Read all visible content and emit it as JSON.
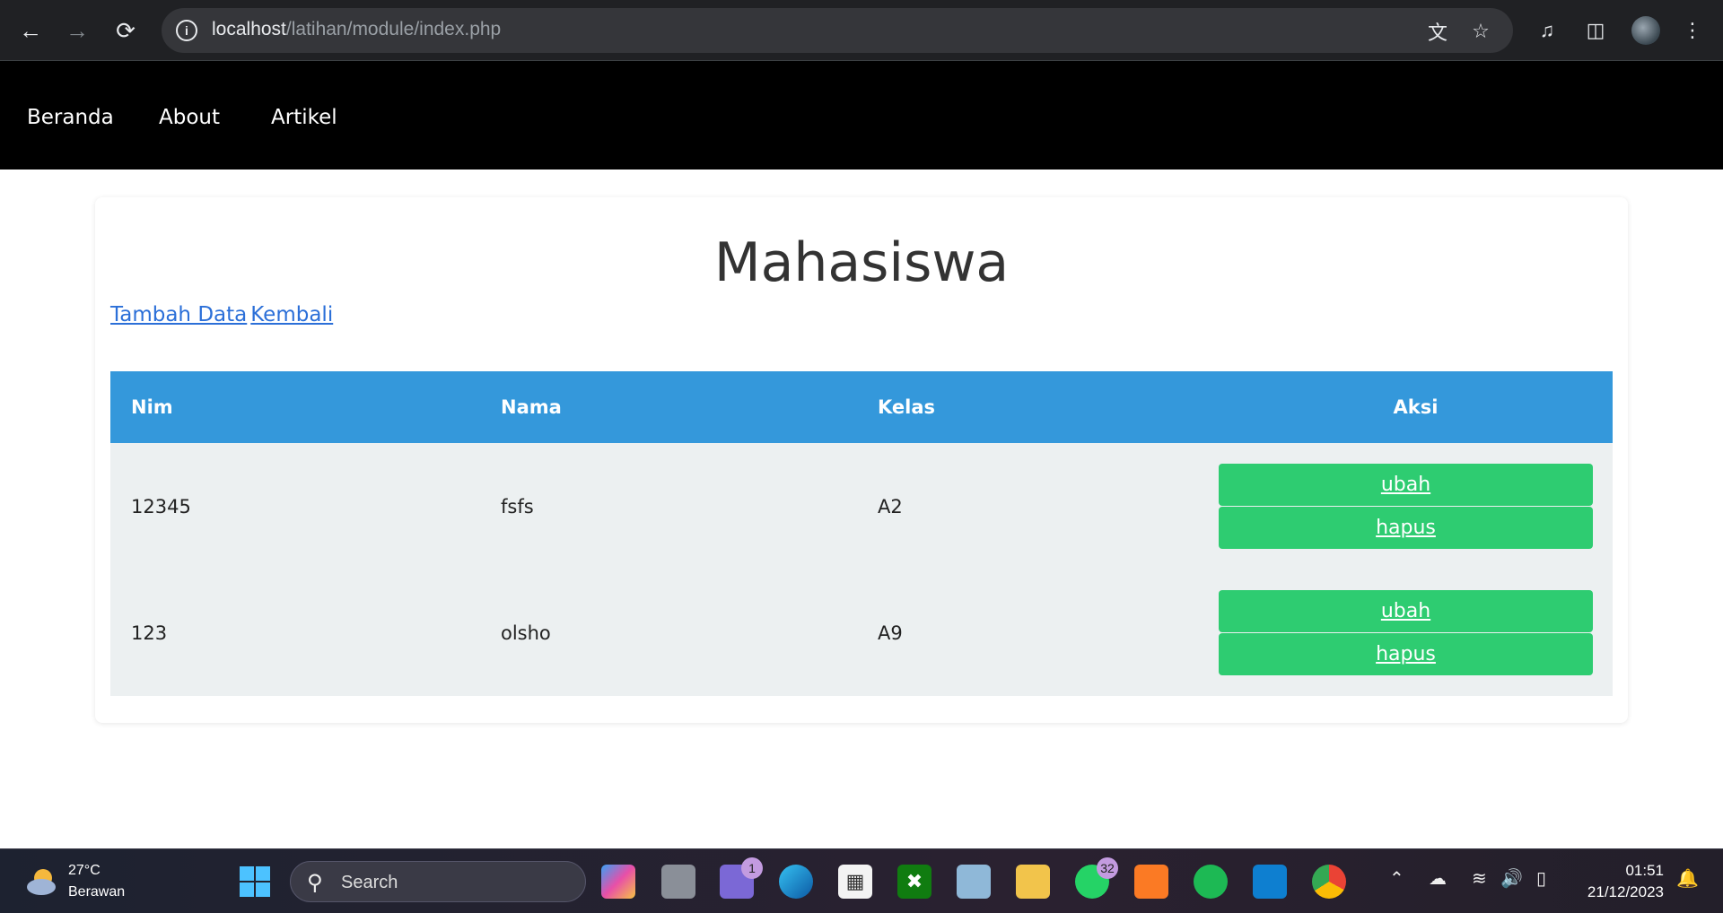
{
  "browser": {
    "url_host": "localhost",
    "url_path": "/latihan/module/index.php"
  },
  "nav": {
    "items": [
      "Beranda",
      "About",
      "Artikel"
    ]
  },
  "page": {
    "title": "Mahasiswa",
    "links": {
      "add": "Tambah Data",
      "back": "Kembali"
    },
    "table": {
      "headers": [
        "Nim",
        "Nama",
        "Kelas",
        "Aksi"
      ],
      "rows": [
        {
          "nim": "12345",
          "nama": "fsfs",
          "kelas": "A2"
        },
        {
          "nim": "123",
          "nama": "olsho",
          "kelas": "A9"
        }
      ],
      "edit_label": "ubah",
      "delete_label": "hapus"
    },
    "colors": {
      "header_bg": "#3498db",
      "button_bg": "#2ecc71",
      "row_bg": "#ecf0f1",
      "nav_bg": "#000000"
    }
  },
  "taskbar": {
    "weather_temp": "27°C",
    "weather_desc": "Berawan",
    "search_placeholder": "Search",
    "teams_badge": "1",
    "whatsapp_badge": "32",
    "time": "01:51",
    "date": "21/12/2023"
  }
}
